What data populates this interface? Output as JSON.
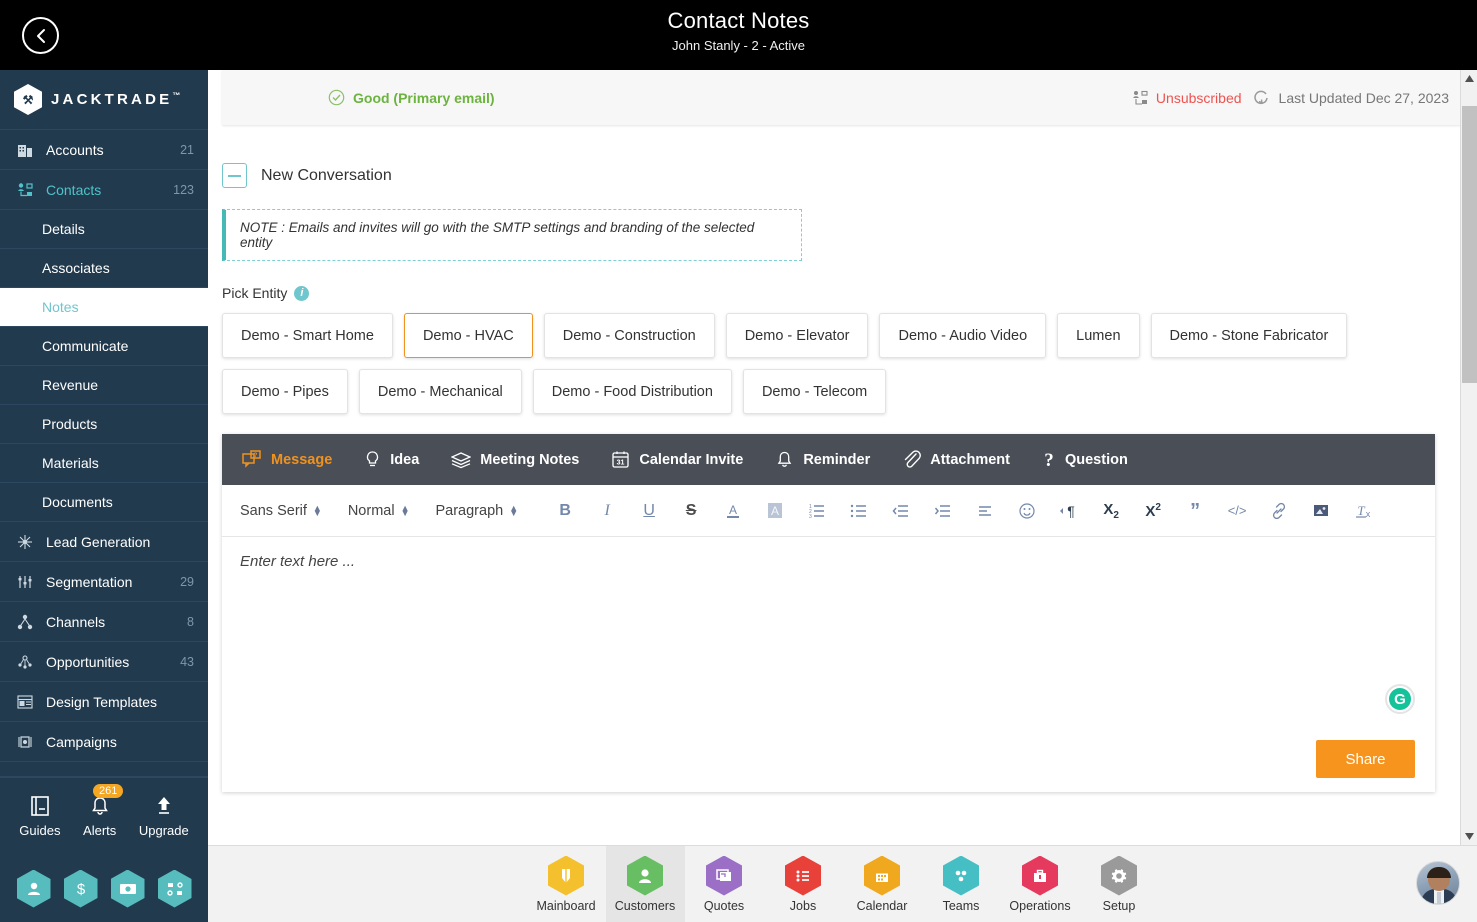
{
  "header": {
    "title": "Contact Notes",
    "subtitle": "John Stanly - 2 - Active",
    "back_icon": "chevron-left-icon"
  },
  "brand": {
    "name": "JACKTRADE",
    "tm": "™",
    "monogram": "JT"
  },
  "sidebar": {
    "items": [
      {
        "label": "Accounts",
        "count": "21",
        "icon": "building-icon",
        "active": false
      },
      {
        "label": "Contacts",
        "count": "123",
        "icon": "contacts-icon",
        "active": true
      }
    ],
    "sub_items": [
      {
        "label": "Details",
        "selected": false
      },
      {
        "label": "Associates",
        "selected": false
      },
      {
        "label": "Notes",
        "selected": true
      },
      {
        "label": "Communicate",
        "selected": false
      },
      {
        "label": "Revenue",
        "selected": false
      },
      {
        "label": "Products",
        "selected": false
      },
      {
        "label": "Materials",
        "selected": false
      },
      {
        "label": "Documents",
        "selected": false
      }
    ],
    "items2": [
      {
        "label": "Lead Generation",
        "count": "",
        "icon": "lead-generation-icon"
      },
      {
        "label": "Segmentation",
        "count": "29",
        "icon": "segmentation-icon"
      },
      {
        "label": "Channels",
        "count": "8",
        "icon": "channels-icon"
      },
      {
        "label": "Opportunities",
        "count": "43",
        "icon": "opportunities-icon"
      },
      {
        "label": "Design Templates",
        "count": "",
        "icon": "design-templates-icon"
      },
      {
        "label": "Campaigns",
        "count": "",
        "icon": "campaigns-icon"
      }
    ],
    "tools": [
      {
        "label": "Guides",
        "icon": "book-icon",
        "badge": ""
      },
      {
        "label": "Alerts",
        "icon": "bell-icon",
        "badge": "261"
      },
      {
        "label": "Upgrade",
        "icon": "up-arrow-icon",
        "badge": ""
      }
    ],
    "quick_icons": [
      "person-hex-icon",
      "dollar-hex-icon",
      "payment-hex-icon",
      "workflow-hex-icon"
    ]
  },
  "status": {
    "email_quality": "Good (Primary email)",
    "email_quality_icon": "check-circle-icon",
    "subscription": "Unsubscribed",
    "subscription_icon": "contact-lock-icon",
    "last_updated": "Last Updated Dec 27, 2023",
    "refresh_icon": "refresh-icon"
  },
  "conversation": {
    "title": "New Conversation",
    "collapse_icon": "minus-box-icon",
    "note": "NOTE : Emails and invites will go with the SMTP settings and branding of the selected entity"
  },
  "pick_entity": {
    "label": "Pick Entity",
    "info_icon": "info-icon",
    "chips": [
      {
        "label": "Demo - Smart Home",
        "selected": false
      },
      {
        "label": "Demo - HVAC",
        "selected": true
      },
      {
        "label": "Demo - Construction",
        "selected": false
      },
      {
        "label": "Demo - Elevator",
        "selected": false
      },
      {
        "label": "Demo - Audio Video",
        "selected": false
      },
      {
        "label": "Lumen",
        "selected": false
      },
      {
        "label": "Demo - Stone Fabricator",
        "selected": false
      },
      {
        "label": "Demo - Pipes",
        "selected": false
      },
      {
        "label": "Demo - Mechanical",
        "selected": false
      },
      {
        "label": "Demo - Food Distribution",
        "selected": false
      },
      {
        "label": "Demo - Telecom",
        "selected": false
      }
    ]
  },
  "editor": {
    "tabs": [
      {
        "label": "Message",
        "icon": "message-icon",
        "active": true
      },
      {
        "label": "Idea",
        "icon": "lightbulb-icon",
        "active": false
      },
      {
        "label": "Meeting Notes",
        "icon": "layers-icon",
        "active": false
      },
      {
        "label": "Calendar Invite",
        "icon": "calendar-31-icon",
        "active": false
      },
      {
        "label": "Reminder",
        "icon": "bell-icon",
        "active": false
      },
      {
        "label": "Attachment",
        "icon": "paperclip-icon",
        "active": false
      },
      {
        "label": "Question",
        "icon": "question-mark-icon",
        "active": false
      }
    ],
    "toolbar": {
      "font_family": "Sans Serif",
      "font_size": "Normal",
      "block_format": "Paragraph",
      "buttons": [
        {
          "name": "bold",
          "glyph": "B"
        },
        {
          "name": "italic",
          "glyph": "I"
        },
        {
          "name": "underline",
          "glyph": "U"
        },
        {
          "name": "strikethrough",
          "glyph": "S"
        },
        {
          "name": "text-color",
          "glyph": "A"
        },
        {
          "name": "background-color",
          "glyph": "A"
        },
        {
          "name": "ordered-list",
          "glyph": "1."
        },
        {
          "name": "bullet-list",
          "glyph": "•"
        },
        {
          "name": "outdent",
          "glyph": ""
        },
        {
          "name": "indent",
          "glyph": ""
        },
        {
          "name": "align",
          "glyph": ""
        },
        {
          "name": "emoji",
          "glyph": "☺"
        },
        {
          "name": "text-direction",
          "glyph": "¶"
        },
        {
          "name": "subscript",
          "glyph": "X2"
        },
        {
          "name": "superscript",
          "glyph": "X2"
        },
        {
          "name": "blockquote",
          "glyph": "”"
        },
        {
          "name": "code-block",
          "glyph": "</>"
        },
        {
          "name": "link",
          "glyph": "🔗"
        },
        {
          "name": "image",
          "glyph": "🖼"
        },
        {
          "name": "clear-format",
          "glyph": "Tx"
        }
      ]
    },
    "placeholder": "Enter text here ...",
    "grammarly_icon": "grammarly-icon",
    "share_label": "Share"
  },
  "bottom_nav": [
    {
      "label": "Mainboard",
      "icon": "mainboard-icon",
      "color": "#f4c02e",
      "active": false
    },
    {
      "label": "Customers",
      "icon": "person-icon",
      "color": "#68bf63",
      "active": true
    },
    {
      "label": "Quotes",
      "icon": "quotes-icon",
      "color": "#9b6fc6",
      "active": false
    },
    {
      "label": "Jobs",
      "icon": "jobs-list-icon",
      "color": "#e8413a",
      "active": false
    },
    {
      "label": "Calendar",
      "icon": "calendar-icon",
      "color": "#f0a91e",
      "active": false
    },
    {
      "label": "Teams",
      "icon": "teams-icon",
      "color": "#46bfc4",
      "active": false
    },
    {
      "label": "Operations",
      "icon": "operations-briefcase-icon",
      "color": "#e53a5e",
      "active": false
    },
    {
      "label": "Setup",
      "icon": "gear-icon",
      "color": "#9a9a9a",
      "active": false
    }
  ],
  "avatar": {
    "name": "user-avatar"
  },
  "colors": {
    "sidebar_bg": "#223a4e",
    "accent_teal": "#6fc6cd",
    "accent_orange": "#f7941d",
    "tabbar_bg": "#4a4f57",
    "good_green": "#6cb33f",
    "unsub_red": "#ef5350"
  }
}
